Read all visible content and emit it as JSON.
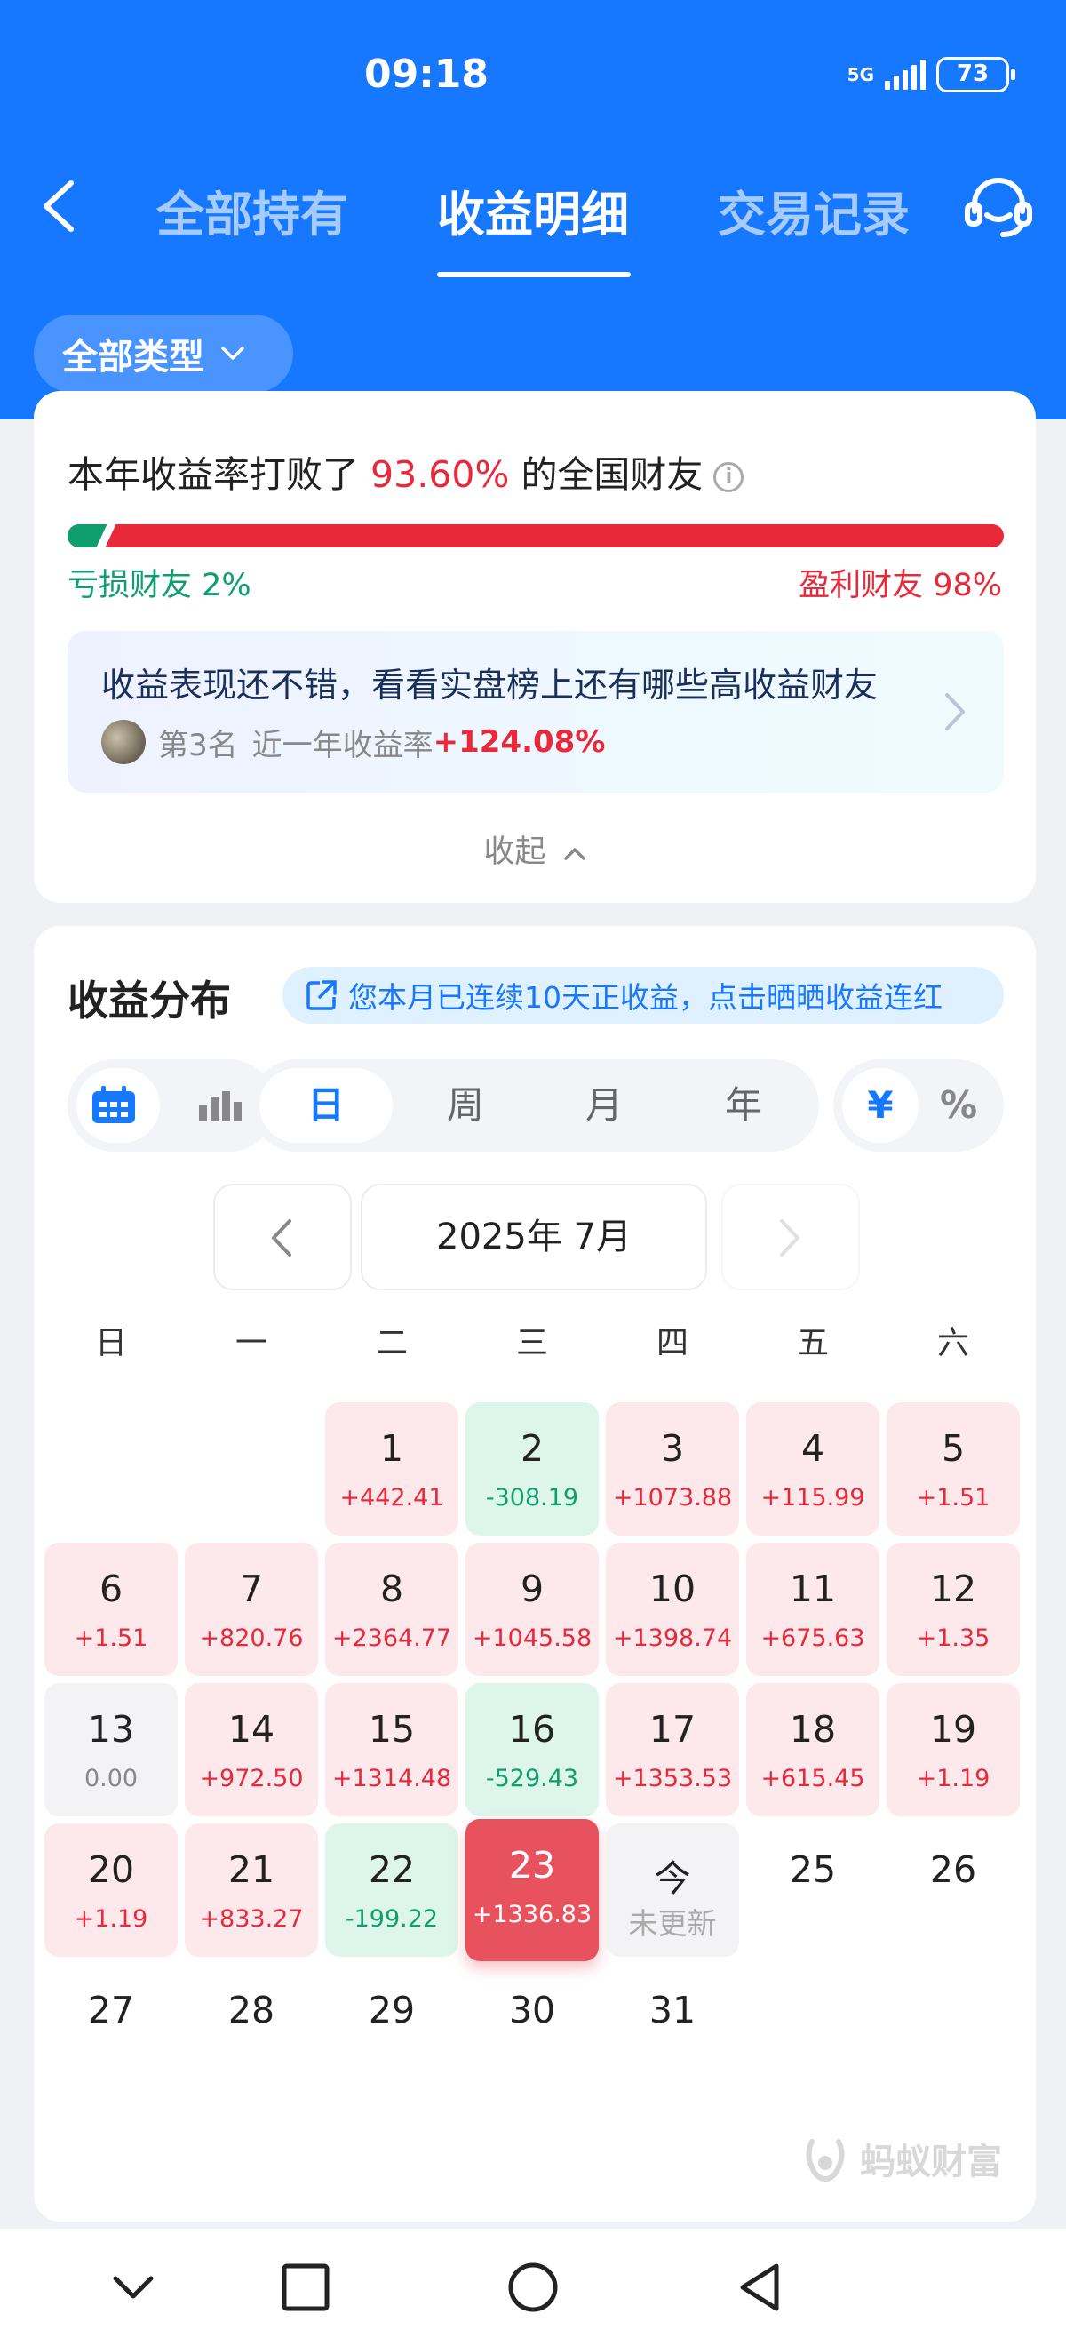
{
  "status": {
    "time": "09:18",
    "network": "5G",
    "battery": "73"
  },
  "header": {
    "tabs": [
      {
        "label": "全部持有"
      },
      {
        "label": "收益明细"
      },
      {
        "label": "交易记录"
      }
    ]
  },
  "filter": {
    "label": "全部类型"
  },
  "ranking": {
    "title_prefix": "本年收益率打败了",
    "percent": "93.60%",
    "title_suffix": "的全国财友",
    "loss_label": "亏损财友 2%",
    "win_label": "盈利财友 98%",
    "loss_fraction": 0.02
  },
  "promo": {
    "text": "收益表现还不错，看看实盘榜上还有哪些高收益财友",
    "rank": "第3名",
    "rate_label": "近一年收益率",
    "rate_value": "+124.08%"
  },
  "collapse_label": "收起",
  "distribution": {
    "title": "收益分布",
    "streak_text": "您本月已连续10天正收益，点击晒晒收益连红"
  },
  "period_tabs": [
    {
      "label": "日"
    },
    {
      "label": "周"
    },
    {
      "label": "月"
    },
    {
      "label": "年"
    }
  ],
  "unit_tabs": [
    {
      "label": "¥"
    },
    {
      "label": "%"
    }
  ],
  "month_label": "2025年 7月",
  "weekdays": [
    "日",
    "一",
    "二",
    "三",
    "四",
    "五",
    "六"
  ],
  "days": [
    {
      "day": "1",
      "value": "+442.41"
    },
    {
      "day": "2",
      "value": "-308.19"
    },
    {
      "day": "3",
      "value": "+1073.88"
    },
    {
      "day": "4",
      "value": "+115.99"
    },
    {
      "day": "5",
      "value": "+1.51"
    },
    {
      "day": "6",
      "value": "+1.51"
    },
    {
      "day": "7",
      "value": "+820.76"
    },
    {
      "day": "8",
      "value": "+2364.77"
    },
    {
      "day": "9",
      "value": "+1045.58"
    },
    {
      "day": "10",
      "value": "+1398.74"
    },
    {
      "day": "11",
      "value": "+675.63"
    },
    {
      "day": "12",
      "value": "+1.35"
    },
    {
      "day": "13",
      "value": "0.00"
    },
    {
      "day": "14",
      "value": "+972.50"
    },
    {
      "day": "15",
      "value": "+1314.48"
    },
    {
      "day": "16",
      "value": "-529.43"
    },
    {
      "day": "17",
      "value": "+1353.53"
    },
    {
      "day": "18",
      "value": "+615.45"
    },
    {
      "day": "19",
      "value": "+1.19"
    },
    {
      "day": "20",
      "value": "+1.19"
    },
    {
      "day": "21",
      "value": "+833.27"
    },
    {
      "day": "22",
      "value": "-199.22"
    },
    {
      "day": "23",
      "value": "+1336.83"
    },
    {
      "day": "今",
      "value": "未更新"
    },
    {
      "day": "25",
      "value": ""
    },
    {
      "day": "26",
      "value": ""
    },
    {
      "day": "27",
      "value": ""
    },
    {
      "day": "28",
      "value": ""
    },
    {
      "day": "29",
      "value": ""
    },
    {
      "day": "30",
      "value": ""
    },
    {
      "day": "31",
      "value": ""
    }
  ],
  "watermark": "蚂蚁财富",
  "colors": {
    "primary": "#1677ff",
    "gain": "#e8293a",
    "loss": "#0f9f6e",
    "selected": "#e8525e"
  }
}
